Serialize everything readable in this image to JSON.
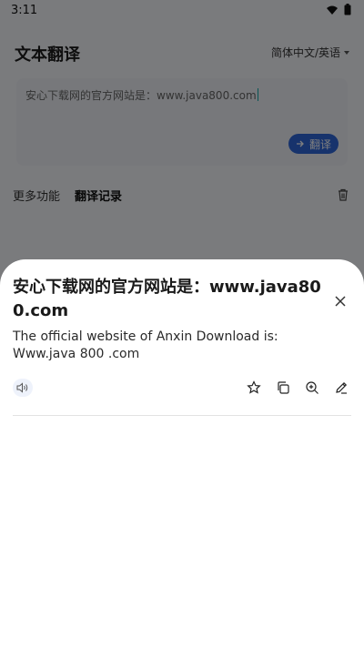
{
  "status": {
    "time": "3:11"
  },
  "header": {
    "title": "文本翻译",
    "language": "简体中文/英语"
  },
  "input": {
    "text": "安心下载网的官方网站是：www.java800.com",
    "translate_label": "翻译"
  },
  "tabs": [
    {
      "label": "更多功能"
    },
    {
      "label": "翻译记录"
    }
  ],
  "sheet": {
    "source": "安心下载网的官方网站是：www.java800.com",
    "translation": "The official website of Anxin Download is: Www.java 800 .com"
  }
}
